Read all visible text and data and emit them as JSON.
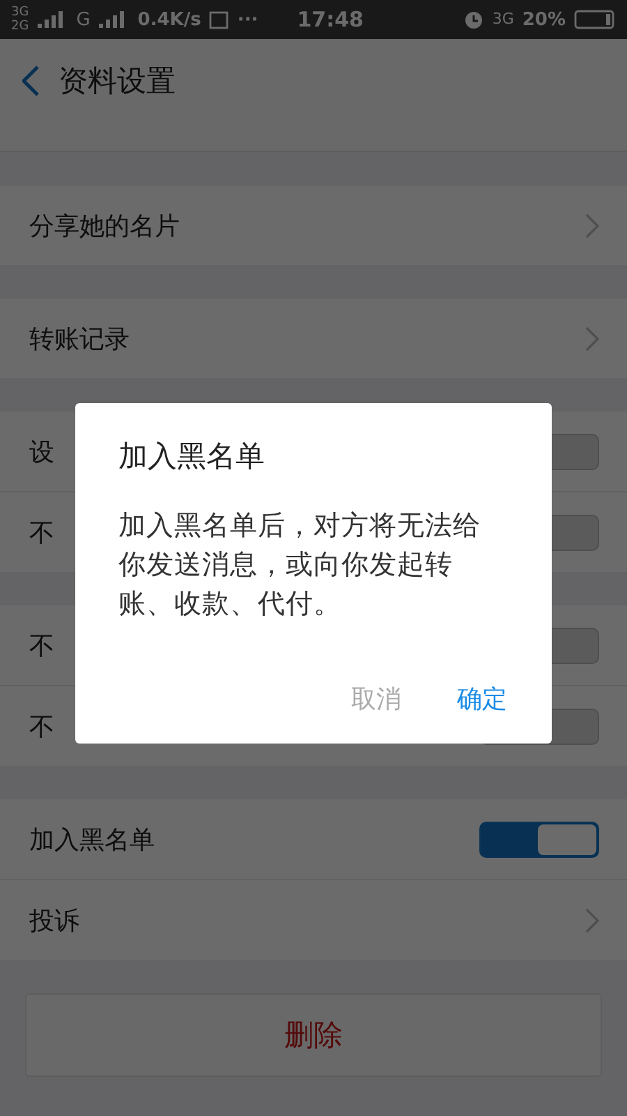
{
  "status_bar": {
    "sim_1": "3G",
    "sim_2": "2G",
    "network": "G",
    "speed": "0.4K/s",
    "more": "···",
    "time": "17:48",
    "data_type": "3G",
    "battery": "20%"
  },
  "header": {
    "title": "资料设置"
  },
  "groups": [
    {
      "rows": [
        {
          "kind": "link",
          "label": "分享她的名片"
        }
      ]
    },
    {
      "rows": [
        {
          "kind": "link",
          "label": "转账记录"
        }
      ]
    },
    {
      "rows": [
        {
          "kind": "toggle",
          "label": "设",
          "on": false
        },
        {
          "kind": "toggle",
          "label": "不",
          "on": false
        }
      ]
    },
    {
      "rows": [
        {
          "kind": "toggle",
          "label": "不",
          "on": false
        },
        {
          "kind": "toggle",
          "label": "不",
          "on": false
        }
      ]
    },
    {
      "rows": [
        {
          "kind": "toggle",
          "label": "加入黑名单",
          "on": true
        },
        {
          "kind": "link",
          "label": "投诉"
        }
      ]
    }
  ],
  "delete_button": "删除",
  "dialog": {
    "title": "加入黑名单",
    "message": "加入黑名单后，对方将无法给你发送消息，或向你发起转账、收款、代付。",
    "buttons": [
      {
        "label": "取消",
        "kind": "cancel"
      },
      {
        "label": "确定",
        "kind": "confirm"
      }
    ]
  }
}
